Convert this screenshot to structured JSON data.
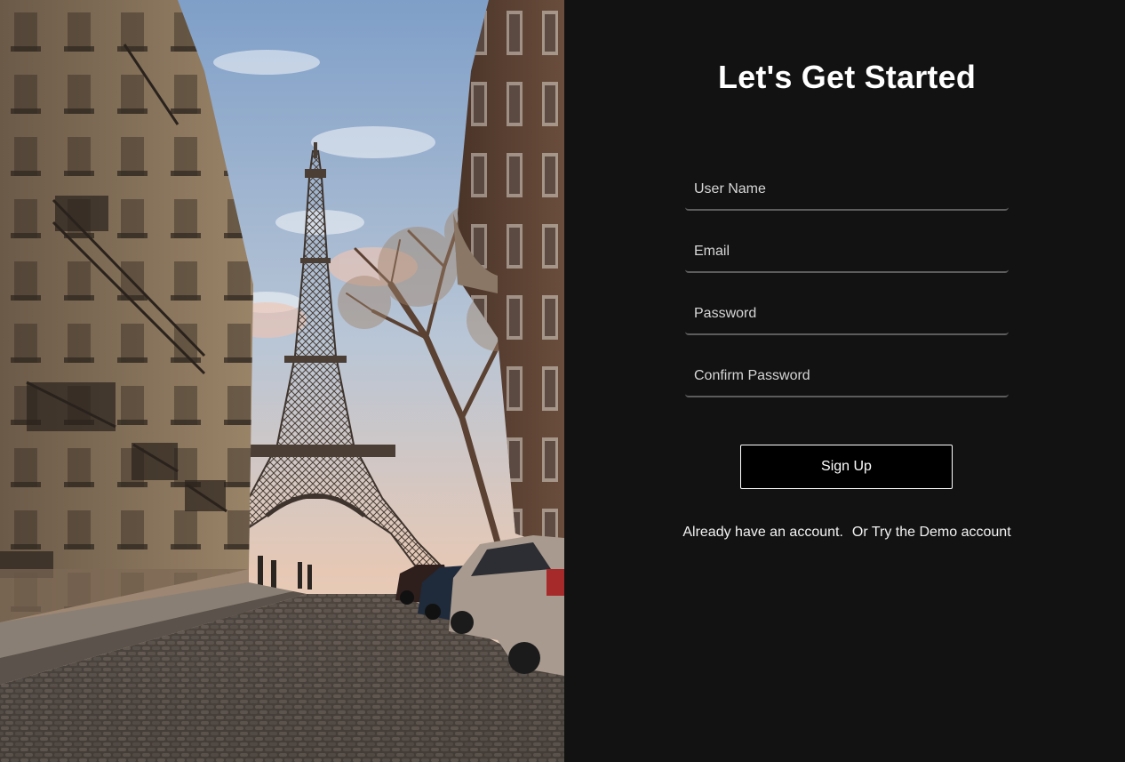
{
  "signup": {
    "title": "Let's Get Started",
    "fields": {
      "username_placeholder": "User Name",
      "email_placeholder": "Email",
      "password_placeholder": "Password",
      "confirm_password_placeholder": "Confirm Password"
    },
    "submit_label": "Sign Up",
    "login_link": "Already have an account.",
    "demo_link": "Or Try the Demo account"
  },
  "colors": {
    "panel_background": "#121212",
    "text": "#ffffff",
    "field_underline": "#5c5c5c",
    "button_background": "#000000"
  }
}
